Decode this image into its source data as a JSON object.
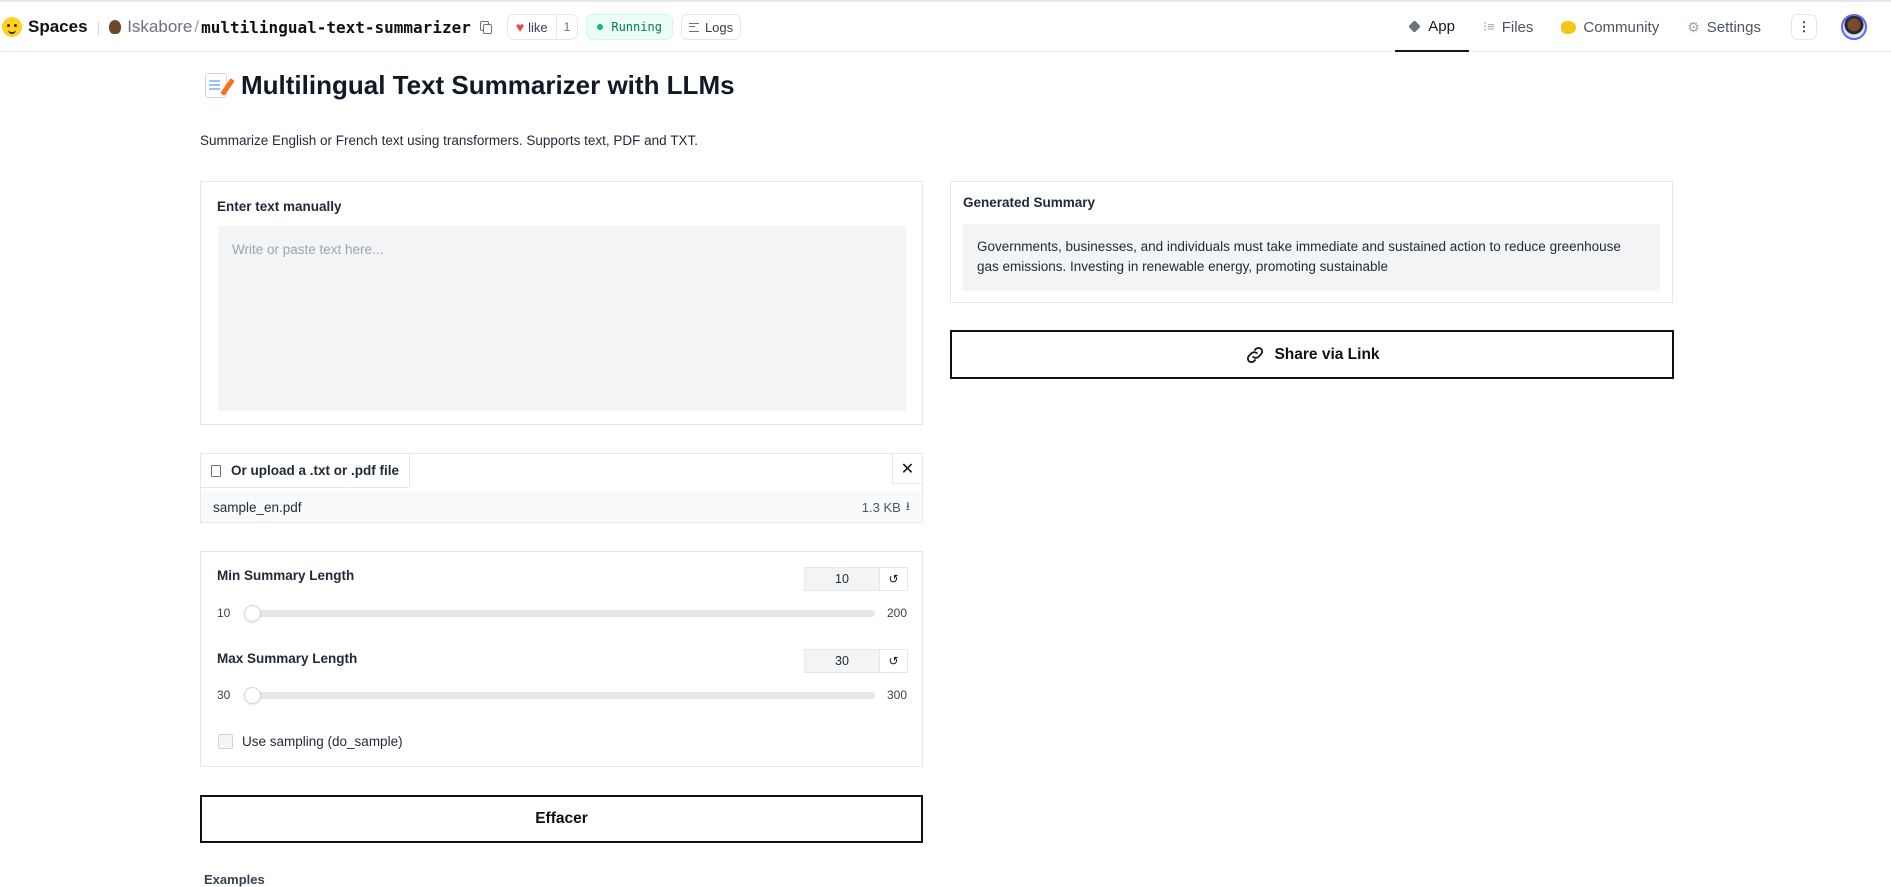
{
  "topbar": {
    "spaces_label": "Spaces",
    "owner": "Iskabore",
    "repo": "multilingual-text-summarizer",
    "like_label": "like",
    "like_count": "1",
    "status": "Running",
    "logs_label": "Logs",
    "tabs": [
      {
        "label": "App",
        "icon": "cube-icon",
        "active": true
      },
      {
        "label": "Files",
        "icon": "files-icon",
        "active": false
      },
      {
        "label": "Community",
        "icon": "community-icon",
        "active": false
      },
      {
        "label": "Settings",
        "icon": "gear-icon",
        "active": false
      }
    ],
    "more_label": "⋮"
  },
  "page": {
    "title": "Multilingual Text Summarizer with LLMs",
    "subtitle": "Summarize English or French text using transformers. Supports text, PDF and TXT."
  },
  "input": {
    "label": "Enter text manually",
    "placeholder": "Write or paste text here..."
  },
  "upload": {
    "label": "Or upload a .txt or .pdf file",
    "file_name": "sample_en.pdf",
    "file_size": "1.3 KB",
    "close_glyph": "✕",
    "download_glyph": "⭳"
  },
  "settings": {
    "min_label": "Min Summary Length",
    "min_value": "10",
    "min_range_min": "10",
    "min_range_max": "200",
    "max_label": "Max Summary Length",
    "max_value": "30",
    "max_range_min": "30",
    "max_range_max": "300",
    "reset_glyph": "↺",
    "sampling_label": "Use sampling (do_sample)",
    "sampling_checked": false
  },
  "actions": {
    "clear_label": "Effacer",
    "share_label": "Share via Link"
  },
  "output": {
    "label": "Generated Summary",
    "summary": "Governments, businesses, and individuals must take immediate and sustained action to reduce greenhouse gas emissions. Investing in renewable energy, promoting sustainable"
  },
  "examples_partial": "Examples",
  "colors": {
    "accent_running": "#10b981",
    "heart": "#ef4444",
    "border": "#e5e7eb",
    "field_bg": "#f3f4f6"
  }
}
